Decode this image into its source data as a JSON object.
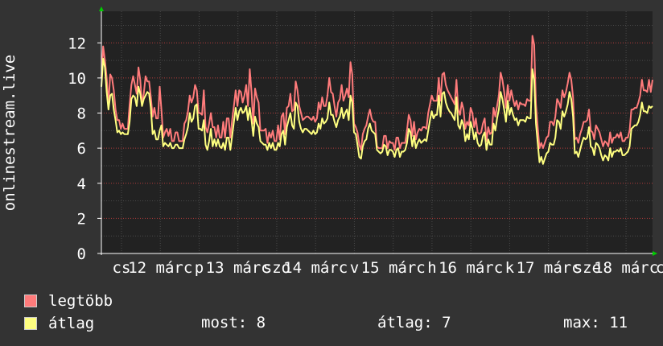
{
  "chart_data": {
    "type": "line",
    "ylabel": "onlinestream.live",
    "ylim": [
      0,
      13.8
    ],
    "yticks": [
      0,
      2,
      4,
      6,
      8,
      10,
      12
    ],
    "x_ticks": [
      "cs",
      "12 márc",
      "p",
      "13 márc",
      "szo",
      "14 márc",
      "v",
      "15 márc",
      "h",
      "16 márc",
      "k",
      "17 márc",
      "sze",
      "18 márc",
      "cs"
    ],
    "grid": true,
    "series": [
      {
        "name": "legtöbb",
        "color": "#ff7b7b",
        "values": [
          10.0,
          11.8,
          11.0,
          10.0,
          8.5,
          10.2,
          10.0,
          9.3,
          8.2,
          7.6,
          7.6,
          7.1,
          7.4,
          7.1,
          7.1,
          7.1,
          8.5,
          9.6,
          10.1,
          9.6,
          9.1,
          10.6,
          9.9,
          8.5,
          9.1,
          10.1,
          9.8,
          9.8,
          8.9,
          7.8,
          8.3,
          7.7,
          7.7,
          9.5,
          8.2,
          6.6,
          6.9,
          7.1,
          6.7,
          7.1,
          6.4,
          6.4,
          6.9,
          6.9,
          6.4,
          6.4,
          6.4,
          7.4,
          7.6,
          8.1,
          9.0,
          8.6,
          8.9,
          9.6,
          9.3,
          8.0,
          8.0,
          7.9,
          9.3,
          7.2,
          6.9,
          7.4,
          8.0,
          7.2,
          7.2,
          6.6,
          7.3,
          6.6,
          6.6,
          7.5,
          6.6,
          7.7,
          7.7,
          6.6,
          7.6,
          8.4,
          9.3,
          8.4,
          9.3,
          9.2,
          8.6,
          9.0,
          9.6,
          8.4,
          10.5,
          9.2,
          7.4,
          9.4,
          8.9,
          8.6,
          7.0,
          7.0,
          7.0,
          7.1,
          6.3,
          6.9,
          6.6,
          7.0,
          6.4,
          6.4,
          7.3,
          6.5,
          7.8,
          8.0,
          6.8,
          8.3,
          8.4,
          9.1,
          8.1,
          8.2,
          9.8,
          9.3,
          8.4,
          8.0,
          7.6,
          7.7,
          7.8,
          7.8,
          7.7,
          7.6,
          7.8,
          7.5,
          7.7,
          8.6,
          8.2,
          8.9,
          8.4,
          8.4,
          9.0,
          10.0,
          9.2,
          9.1,
          8.4,
          7.8,
          8.6,
          8.8,
          9.6,
          8.7,
          9.0,
          9.4,
          8.9,
          10.9,
          10.2,
          7.4,
          7.2,
          6.9,
          6.2,
          5.9,
          6.8,
          7.1,
          7.3,
          7.8,
          8.2,
          7.7,
          7.5,
          7.5,
          6.1,
          6.0,
          6.0,
          6.0,
          6.7,
          6.7,
          6.0,
          6.4,
          6.3,
          6.3,
          5.9,
          6.6,
          6.6,
          6.0,
          6.3,
          6.3,
          6.3,
          7.0,
          7.9,
          7.6,
          6.7,
          7.5,
          6.5,
          6.9,
          7.1,
          7.0,
          7.2,
          7.2,
          7.1,
          8.0,
          8.5,
          9.0,
          8.7,
          8.7,
          8.7,
          10.0,
          8.7,
          10.2,
          10.3,
          9.6,
          9.3,
          9.1,
          8.9,
          8.7,
          8.5,
          9.9,
          8.2,
          7.9,
          8.6,
          8.2,
          7.1,
          7.5,
          7.3,
          8.3,
          8.0,
          7.2,
          7.7,
          6.9,
          6.8,
          6.9,
          7.4,
          7.7,
          6.4,
          7.2,
          6.8,
          6.9,
          8.3,
          7.8,
          8.4,
          9.0,
          10.3,
          9.9,
          9.2,
          8.3,
          9.6,
          8.7,
          9.3,
          8.8,
          8.4,
          8.7,
          8.2,
          8.6,
          8.5,
          8.5,
          8.4,
          8.8,
          8.7,
          8.7,
          12.4,
          11.9,
          8.5,
          7.2,
          6.0,
          6.3,
          6.0,
          6.3,
          6.6,
          6.7,
          7.5,
          7.5,
          7.3,
          7.8,
          8.8,
          8.6,
          8.3,
          9.3,
          8.9,
          9.2,
          9.7,
          10.3,
          9.9,
          8.9,
          6.5,
          6.6,
          6.3,
          6.8,
          7.1,
          7.5,
          7.5,
          7.6,
          8.2,
          7.0,
          6.9,
          6.5,
          7.3,
          7.1,
          6.9,
          6.5,
          6.1,
          6.4,
          6.3,
          6.1,
          6.9,
          6.3,
          6.6,
          6.6,
          6.8,
          6.6,
          6.9,
          6.4,
          6.4,
          6.6,
          6.6,
          7.0,
          8.2,
          8.2,
          8.3,
          8.3,
          8.6,
          9.0,
          9.9,
          9.3,
          9.3,
          9.2,
          9.9,
          9.2,
          9.9
        ]
      },
      {
        "name": "átlag",
        "color": "#ffff80",
        "values": [
          9.5,
          11.1,
          10.6,
          9.2,
          8.2,
          9.0,
          9.1,
          8.2,
          7.6,
          6.9,
          7.0,
          6.8,
          6.9,
          6.8,
          6.8,
          6.8,
          7.5,
          8.8,
          9.0,
          8.9,
          8.4,
          9.5,
          9.1,
          8.4,
          8.8,
          9.0,
          9.2,
          9.1,
          8.3,
          6.8,
          7.0,
          6.5,
          6.5,
          7.0,
          7.3,
          6.1,
          6.3,
          6.2,
          6.1,
          6.3,
          6.0,
          6.0,
          6.2,
          6.2,
          6.0,
          6.0,
          6.0,
          6.5,
          6.8,
          7.2,
          8.0,
          7.5,
          7.7,
          8.4,
          8.5,
          7.1,
          7.1,
          7.0,
          7.6,
          6.2,
          5.9,
          6.4,
          7.1,
          6.1,
          6.5,
          6.1,
          6.5,
          6.1,
          6.0,
          6.3,
          5.9,
          6.6,
          6.6,
          5.9,
          6.7,
          7.5,
          8.3,
          7.6,
          8.1,
          8.3,
          8.0,
          8.1,
          8.4,
          7.6,
          8.3,
          7.6,
          6.7,
          7.8,
          7.4,
          7.2,
          6.4,
          6.3,
          6.2,
          6.2,
          5.9,
          6.3,
          6.0,
          6.3,
          5.9,
          5.9,
          6.3,
          6.1,
          6.8,
          7.0,
          6.2,
          7.2,
          7.6,
          8.0,
          7.3,
          7.1,
          8.6,
          8.4,
          7.5,
          7.1,
          6.9,
          7.1,
          7.1,
          7.0,
          6.9,
          6.8,
          7.0,
          6.8,
          6.9,
          7.4,
          7.1,
          7.7,
          7.4,
          7.5,
          7.7,
          8.6,
          7.9,
          7.9,
          7.5,
          7.2,
          7.6,
          7.8,
          8.3,
          7.7,
          8.0,
          8.2,
          7.6,
          9.0,
          8.6,
          6.9,
          6.8,
          6.2,
          5.5,
          5.4,
          6.1,
          6.4,
          6.5,
          7.1,
          7.4,
          7.0,
          6.9,
          6.8,
          5.9,
          5.8,
          5.7,
          5.8,
          6.2,
          6.1,
          5.6,
          5.9,
          5.9,
          5.8,
          5.5,
          5.9,
          6.0,
          5.5,
          5.8,
          5.8,
          5.9,
          6.3,
          7.1,
          6.9,
          6.1,
          6.7,
          6.0,
          6.3,
          6.5,
          6.3,
          6.4,
          6.5,
          6.4,
          7.0,
          7.6,
          8.1,
          7.7,
          7.9,
          7.9,
          9.0,
          7.8,
          9.1,
          9.2,
          8.6,
          8.3,
          8.1,
          8.0,
          7.8,
          7.6,
          8.9,
          7.3,
          7.1,
          7.6,
          7.3,
          6.4,
          6.8,
          6.5,
          7.5,
          7.1,
          6.5,
          6.9,
          6.3,
          6.1,
          6.2,
          6.7,
          6.9,
          5.9,
          6.5,
          6.2,
          6.2,
          7.4,
          7.0,
          7.7,
          8.2,
          9.2,
          8.8,
          8.2,
          7.5,
          8.7,
          7.9,
          8.3,
          7.9,
          7.6,
          7.7,
          7.3,
          7.6,
          7.6,
          7.6,
          7.5,
          7.8,
          7.7,
          7.7,
          10.5,
          9.9,
          7.4,
          6.3,
          5.2,
          5.5,
          5.1,
          5.4,
          5.7,
          5.8,
          6.3,
          6.2,
          6.2,
          6.6,
          7.6,
          7.5,
          7.1,
          8.1,
          7.8,
          8.1,
          8.5,
          9.2,
          8.8,
          7.8,
          5.7,
          5.8,
          5.5,
          5.9,
          6.3,
          6.6,
          6.5,
          6.6,
          7.2,
          6.1,
          6.0,
          5.6,
          6.3,
          6.2,
          6.0,
          5.6,
          5.3,
          5.6,
          5.5,
          5.3,
          6.0,
          5.5,
          5.8,
          5.8,
          5.9,
          5.8,
          6.0,
          5.6,
          5.6,
          5.7,
          5.8,
          6.1,
          7.1,
          7.2,
          7.3,
          7.3,
          7.5,
          7.9,
          8.6,
          8.1,
          8.1,
          8.0,
          8.4,
          8.3,
          8.4
        ]
      }
    ]
  },
  "legend": [
    {
      "label": "legtöbb",
      "color": "#ff7b7b"
    },
    {
      "label": "átlag",
      "color": "#ffff80"
    }
  ],
  "stats": {
    "most": "most: 8",
    "atlag": "átlag: 7",
    "max": "max: 11"
  }
}
